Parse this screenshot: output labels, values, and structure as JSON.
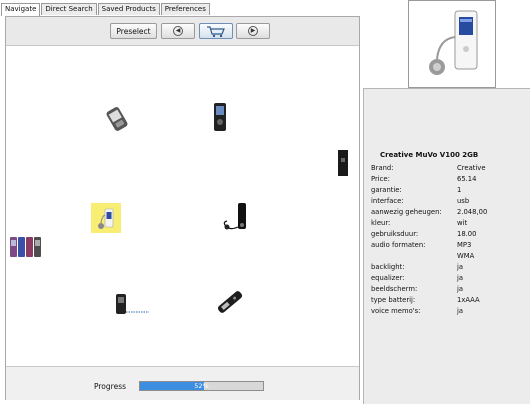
{
  "tabs": [
    {
      "label": "Navigate",
      "active": true
    },
    {
      "label": "Direct Search",
      "active": false
    },
    {
      "label": "Saved Products",
      "active": false
    },
    {
      "label": "Preferences",
      "active": false
    }
  ],
  "toolbar": {
    "preselect_label": "Preselect",
    "back_icon": "left-arrow-circle-icon",
    "cart_icon": "shopping-cart-icon",
    "forward_icon": "right-arrow-circle-icon"
  },
  "status": {
    "progress_label": "Progress",
    "progress_value": 0.52,
    "progress_text": "52%",
    "accent_color": "#3c8ee0"
  },
  "details": {
    "title": "Creative MuVo V100 2GB",
    "rows": [
      {
        "key": "Brand:",
        "value": "Creative"
      },
      {
        "key": "Price:",
        "value": "65.14"
      },
      {
        "key": "garantie:",
        "value": "1"
      },
      {
        "key": "interface:",
        "value": "usb"
      },
      {
        "key": "aanwezig geheugen:",
        "value": "2.048,00"
      },
      {
        "key": "kleur:",
        "value": "wit"
      },
      {
        "key": "gebruiksduur:",
        "value": "18.00"
      },
      {
        "key": "audio formaten:",
        "value": "MP3"
      },
      {
        "key": "",
        "value": "WMA"
      },
      {
        "key": "backlight:",
        "value": "ja"
      },
      {
        "key": "equalizer:",
        "value": "ja"
      },
      {
        "key": "beeldscherm:",
        "value": "ja"
      },
      {
        "key": "type batterij:",
        "value": "1xAAA"
      },
      {
        "key": "voice memo's:",
        "value": "ja"
      }
    ]
  }
}
